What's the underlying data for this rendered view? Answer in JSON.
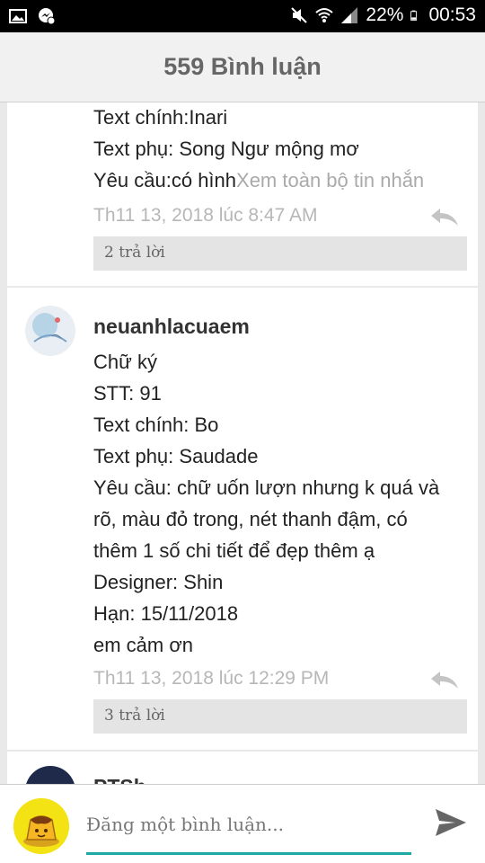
{
  "status_bar": {
    "battery": "22%",
    "time": "00:53",
    "icons": [
      "image-icon",
      "messenger-icon",
      "mute-icon",
      "wifi-icon",
      "signal-icon",
      "battery-icon"
    ]
  },
  "header": {
    "title": "559 Bình luận"
  },
  "comments": [
    {
      "lines": [
        "Text chính:Inari",
        "Text phụ: Song Ngư mộng mơ",
        "Yêu cầu:có hình"
      ],
      "view_more": "Xem toàn bộ tin nhắn",
      "timestamp": "Th11 13, 2018 lúc 8:47 AM",
      "replies": "2 trả lời"
    },
    {
      "author": "neuanhlacuaem",
      "lines": [
        "Chữ ký",
        "STT: 91",
        "Text chính: Bo",
        "Text phụ: Saudade",
        "Yêu cầu: chữ uốn lượn nhưng k quá và",
        "rõ, màu đỏ trong, nét thanh đậm, có",
        "thêm 1 số chi tiết để đẹp thêm ạ",
        "Designer:  Shin",
        "Hạn: 15/11/2018",
        "em cảm ơn"
      ],
      "timestamp": "Th11 13, 2018 lúc 12:29 PM",
      "replies": "3 trả lời"
    },
    {
      "author": "PTSh..."
    }
  ],
  "composer": {
    "placeholder": "Đăng một bình luận..."
  },
  "colors": {
    "accent": "#1fa9a3",
    "header_bg": "#f1f1f1"
  }
}
